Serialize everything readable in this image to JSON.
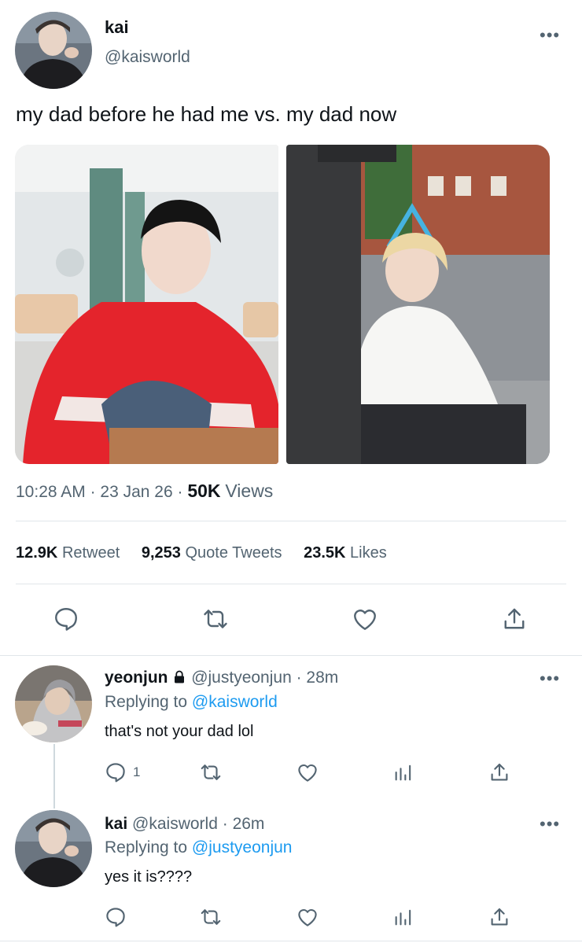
{
  "tweet": {
    "author_name": "kai",
    "author_handle": "@kaisworld",
    "text": "my dad before he had me vs. my dad now",
    "time": "10:28 AM",
    "date": "23 Jan 26",
    "views_count": "50K",
    "views_label": "Views",
    "retweets_count": "12.9K",
    "retweets_label": "Retweet",
    "quotes_count": "9,253",
    "quotes_label": "Quote Tweets",
    "likes_count": "23.5K",
    "likes_label": "Likes"
  },
  "replies": [
    {
      "author_name": "yeonjun",
      "author_handle": "@justyeonjun",
      "time": "· 28m",
      "replying_prefix": "Replying to",
      "replying_to": "@kaisworld",
      "text": "that's not your dad lol",
      "reply_count": "1",
      "protected": true
    },
    {
      "author_name": "kai",
      "author_handle": "@kaisworld",
      "time": "· 26m",
      "replying_prefix": "Replying to",
      "replying_to": "@justyeonjun",
      "text": "yes it is????",
      "reply_count": ""
    }
  ],
  "icons": [
    "more-icon",
    "reply-icon",
    "retweet-icon",
    "like-icon",
    "share-icon",
    "analytics-icon",
    "lock-icon"
  ],
  "colors": {
    "link": "#1d9bf0",
    "secondary_text": "#536471",
    "divider": "#e1e6ea"
  }
}
